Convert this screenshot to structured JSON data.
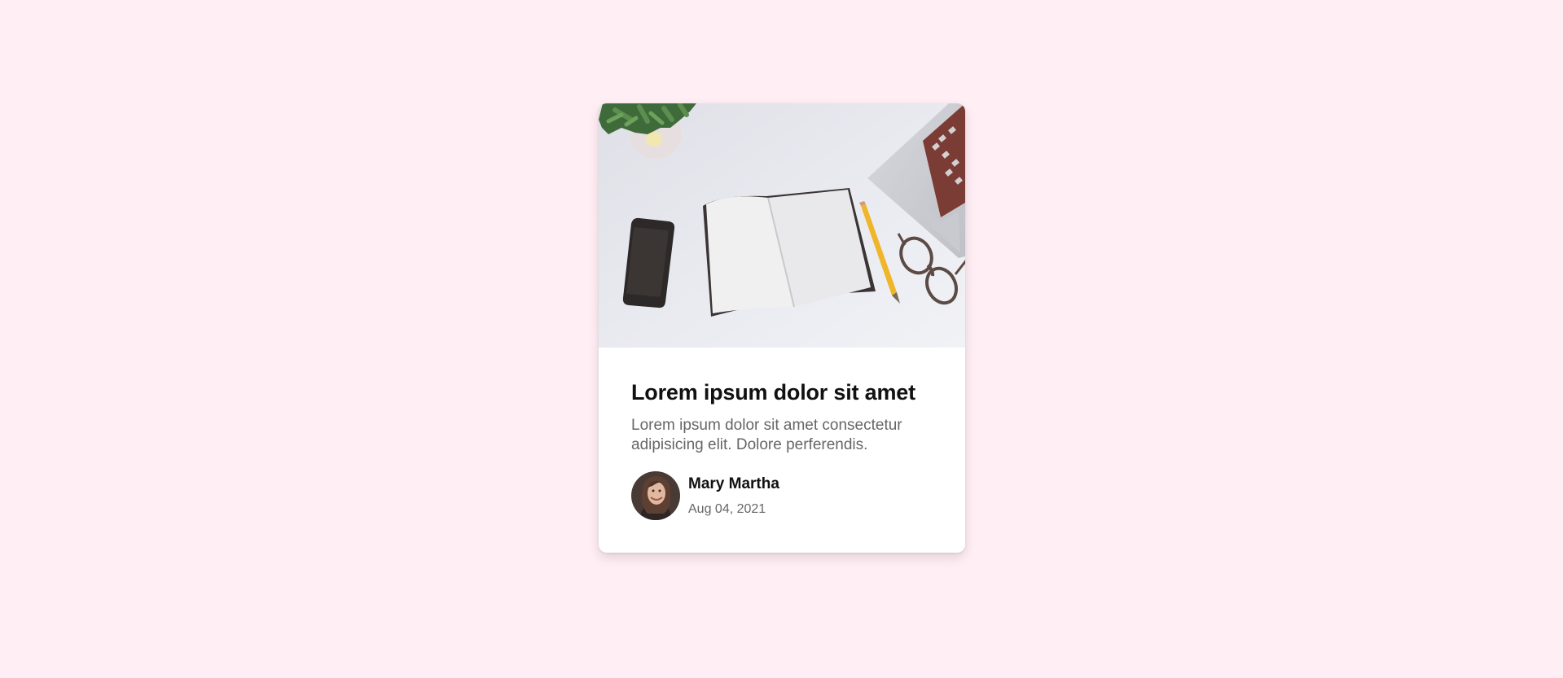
{
  "card": {
    "image_icon": "desk-workspace-photo",
    "title": "Lorem ipsum dolor sit amet",
    "description": "Lorem ipsum dolor sit amet consectetur adipisicing elit. Dolore perferendis.",
    "author": {
      "name": "Mary Martha",
      "date": "Aug 04, 2021",
      "avatar_icon": "user-avatar-photo"
    }
  },
  "colors": {
    "background": "#ffeef4",
    "card": "#ffffff",
    "title": "#111111",
    "muted_text": "#666666"
  }
}
